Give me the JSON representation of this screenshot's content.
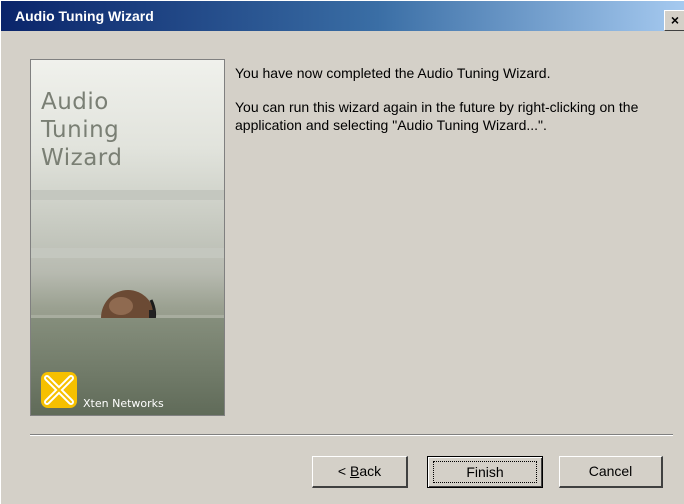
{
  "window": {
    "title": "Audio Tuning Wizard",
    "close_glyph": "×"
  },
  "side_panel": {
    "title_line1": "Audio",
    "title_line2": "Tuning",
    "title_line3": "Wizard",
    "brand_name": "Xten Networks",
    "brand_color": "#f6c000"
  },
  "content": {
    "message1": "You have now completed the Audio Tuning Wizard.",
    "message2": "You can run this wizard again in the future by right-clicking on the application and selecting \"Audio Tuning Wizard...\"."
  },
  "buttons": {
    "back_prefix": "< ",
    "back_accel": "B",
    "back_rest": "ack",
    "finish_label": "Finish",
    "cancel_label": "Cancel"
  },
  "colors": {
    "titlebar_start": "#0a246a",
    "titlebar_end": "#a6caf0",
    "dialog_face": "#d4d0c8"
  }
}
